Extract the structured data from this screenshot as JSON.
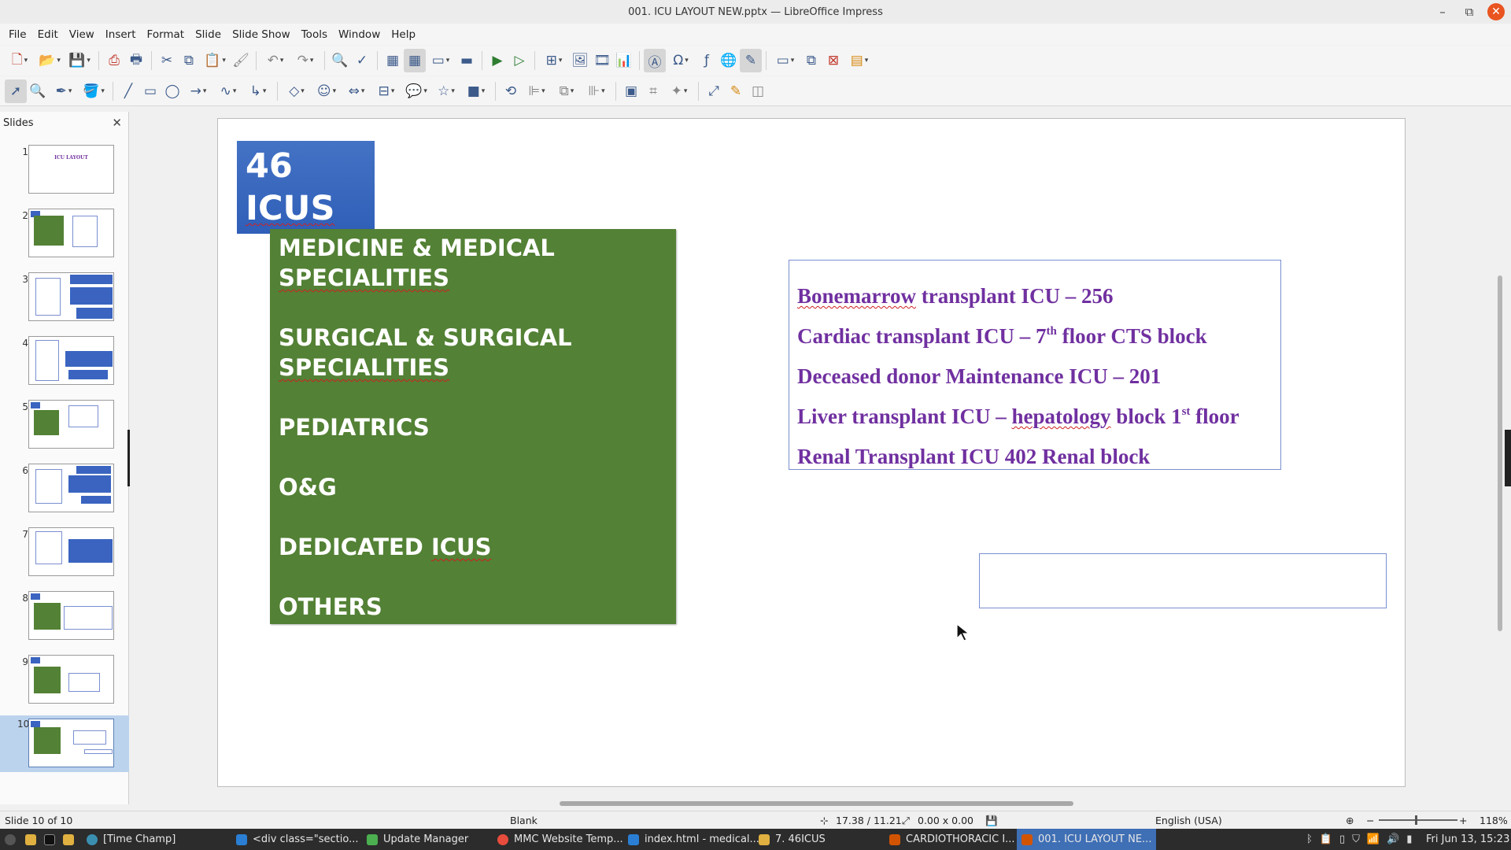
{
  "window": {
    "title": "001. ICU LAYOUT NEW.pptx — LibreOffice Impress",
    "minimize": "–",
    "maximize": "⧉",
    "close": "✕"
  },
  "menu": [
    "File",
    "Edit",
    "View",
    "Insert",
    "Format",
    "Slide",
    "Slide Show",
    "Tools",
    "Window",
    "Help"
  ],
  "slides_pane": {
    "title": "Slides",
    "close": "✕",
    "thumbnail_1_title": "ICU LAYOUT",
    "numbers": [
      "1",
      "2",
      "3",
      "4",
      "5",
      "6",
      "7",
      "8",
      "9",
      "10"
    ],
    "selected": 10
  },
  "slide": {
    "icus_line1": "46",
    "icus_line2": "ICUS",
    "green_items": {
      "item1_a": "MEDICINE & MEDICAL",
      "item1_b": "SPECIALITIES",
      "item2_a": "SURGICAL & SURGICAL",
      "item2_b": "SPECIALITIES",
      "item3": "PEDIATRICS",
      "item4": "O&G",
      "item5_a": "DEDICATED ",
      "item5_b": "ICUS",
      "item6": "OTHERS"
    },
    "list": {
      "l1_a": "Bonemarrow",
      "l1_b": " transplant ICU – 256",
      "l2_a": "Cardiac transplant ICU – 7",
      "l2_sup": "th",
      "l2_b": " floor CTS block",
      "l3": "Deceased donor Maintenance ICU – 201",
      "l4_a": "Liver transplant ICU – ",
      "l4_b": "hepatology",
      "l4_c": " block 1",
      "l4_sup": "st",
      "l4_d": " floor",
      "l5": "Renal Transplant ICU 402 Renal block"
    },
    "accent_colors": {
      "blue_box": "#4472c4",
      "green_box": "#538135",
      "list_text": "#7030a0"
    }
  },
  "status": {
    "slide_info": "Slide 10 of 10",
    "layout": "Blank",
    "position": "17.38 / 11.21",
    "size": "0.00 x 0.00",
    "language": "English (USA)",
    "zoom": "118%"
  },
  "taskbar": {
    "items": [
      "[Time Champ]",
      "<div class=\"sectio...",
      "Update Manager",
      "MMC Website Temp...",
      "index.html - medical...",
      "7. 46ICUS",
      "CARDIOTHORACIC I...",
      "001. ICU LAYOUT NE..."
    ],
    "clock": "Fri Jun 13, 15:23"
  }
}
